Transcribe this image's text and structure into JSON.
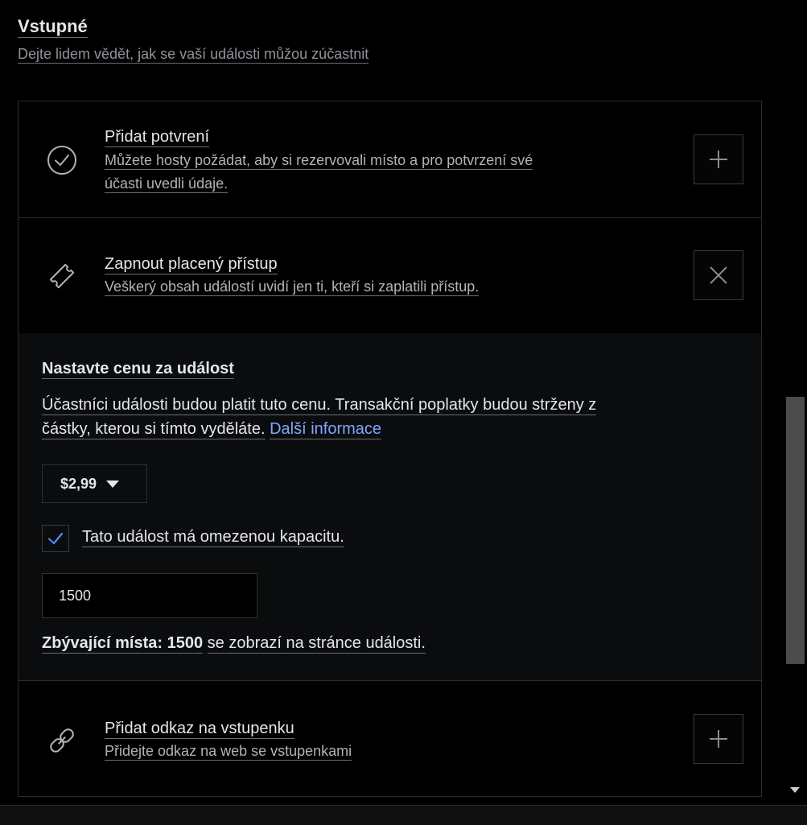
{
  "section": {
    "title": "Vstupné",
    "subtitle": "Dejte lidem vědět, jak se vaší události můžou zúčastnit"
  },
  "options": {
    "rsvp": {
      "title": "Přidat potvrení",
      "description_line1": "Můžete hosty požádat, aby si rezervovali místo a pro potvrzení své",
      "description_line2": "účasti uvedli údaje.",
      "icon": "check-circle-icon",
      "action_icon": "plus-icon"
    },
    "paid": {
      "title": "Zapnout placený přístup",
      "description": "Veškerý obsah událostí uvidí jen ti, kteří si zaplatili přístup.",
      "icon": "ticket-icon",
      "action_icon": "close-icon"
    },
    "ticket_link": {
      "title": "Přidat odkaz na vstupenku",
      "description": "Přidejte odkaz na web se vstupenkami",
      "icon": "link-icon",
      "action_icon": "plus-icon"
    }
  },
  "pricing": {
    "title": "Nastavte cenu za událost",
    "description_line1": "Účastníci události budou platit tuto cenu. Transakční poplatky budou strženy z",
    "description_line2": "částky, kterou si tímto vyděláte.",
    "more_info_link": "Další informace",
    "price_value": "$2,99",
    "capacity_checkbox_label": "Tato událost má omezenou kapacitu.",
    "capacity_checked": true,
    "capacity_value": "1500",
    "remaining_label": "Zbývající místa: 1500",
    "remaining_suffix": "se zobrazí na stránce události."
  },
  "colors": {
    "background": "#000000",
    "link": "#7fa7ff",
    "check": "#4e8cff",
    "scroll_thumb": "#4a4b4d"
  }
}
